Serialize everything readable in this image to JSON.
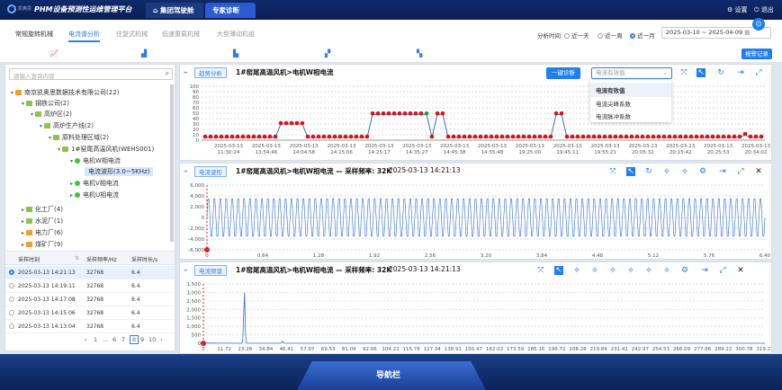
{
  "app": {
    "logo_text": "凯奥思",
    "title": "PHM设备预测性运维管理平台",
    "tabs": [
      {
        "label": "集团驾驶舱"
      },
      {
        "label": "专家诊断"
      }
    ],
    "settings": "设置",
    "logout": "退出"
  },
  "subnav": {
    "machine_tabs": [
      "常规旋转机械",
      "往复式机械",
      "低速重载机械",
      "大型薄动机组"
    ],
    "analysis_tab": "电流谱分析",
    "time_label": "分析时间:",
    "ranges": [
      "近一天",
      "近一周",
      "近一月"
    ],
    "selected_range": "近一月",
    "start_date": "2025-03-10",
    "date_sep": "~",
    "end_date": "2025-04-09",
    "record_button": "报警记录"
  },
  "search": {
    "placeholder": "请输入查询内容"
  },
  "tree": [
    {
      "label": "南京凯奥思数据技术有限公司(22)"
    },
    {
      "label": "钢铁公司(2)"
    },
    {
      "label": "高炉区(2)"
    },
    {
      "label": "高炉生产线(2)"
    },
    {
      "label": "原料处理区域(2)"
    },
    {
      "label": "1#窑尾高温风机(WEHS001)"
    },
    {
      "label": "电机W相电流"
    },
    {
      "label": "电流波形(3.0~5KHz)"
    },
    {
      "label": "电机V相电流"
    },
    {
      "label": "电机U相电流"
    },
    {
      "label": "化工厂(4)"
    },
    {
      "label": "水泥厂(1)"
    },
    {
      "label": "电力厂(6)"
    },
    {
      "label": "煤矿厂(9)"
    }
  ],
  "samples": {
    "headers": [
      "采样时刻",
      "采样频率/Hz",
      "采样时长/s"
    ],
    "rows": [
      [
        "2025-03-13 14:21:13",
        "32768",
        "6.4"
      ],
      [
        "2025-03-13 14:19:11",
        "32768",
        "6.4"
      ],
      [
        "2025-03-13 14:17:08",
        "32768",
        "6.4"
      ],
      [
        "2025-03-13 14:15:06",
        "32768",
        "6.4"
      ],
      [
        "2025-03-13 14:13:04",
        "32768",
        "6.4"
      ]
    ],
    "pagination": {
      "prev": "‹",
      "pages": [
        "1",
        "…",
        "6",
        "7",
        "8",
        "9",
        "10"
      ],
      "current": "8",
      "next": "›"
    }
  },
  "trend": {
    "tag": "趋势分析",
    "title": "1#窑尾高温风机>电机W相电流",
    "diag_button": "一键诊断",
    "select_value": "电流有效值",
    "options": [
      "电流有效值",
      "电流尖峰系数",
      "电流脉冲系数"
    ],
    "yticks": [
      "100",
      "90",
      "80",
      "70",
      "60",
      "50",
      "40",
      "30",
      "20",
      "10",
      "0"
    ],
    "xticks": [
      [
        "2025-03-13",
        "11:30:24"
      ],
      [
        "2025-03-13",
        "13:54:46"
      ],
      [
        "2025-03-13",
        "14:04:58"
      ],
      [
        "2025-03-13",
        "14:15:06"
      ],
      [
        "2025-03-13",
        "14:25:17"
      ],
      [
        "2025-03-13",
        "14:35:27"
      ],
      [
        "2025-03-13",
        "14:45:38"
      ],
      [
        "2025-03-13",
        "14:55:48"
      ],
      [
        "2025-03-13",
        "19:25:00"
      ],
      [
        "2025-03-13",
        "19:45:11"
      ],
      [
        "2025-03-13",
        "19:55:21"
      ],
      [
        "2025-03-13",
        "20:05:32"
      ],
      [
        "2025-03-13",
        "20:15:42"
      ],
      [
        "2025-03-13",
        "20:25:53"
      ],
      [
        "2025-03-13",
        "20:34:02"
      ]
    ]
  },
  "wave": {
    "tag": "电流波形",
    "title": "1#窑尾高温风机>电机W相电流 — 采样频率: 32K",
    "time": "2025-03-13 14:21:13",
    "yticks": [
      "6,000",
      "4,000",
      "2,000",
      "0",
      "-2,000",
      "-4,000",
      "-6,000"
    ],
    "xticks": [
      "0",
      "0.64",
      "1.28",
      "1.92",
      "2.56",
      "3.20",
      "3.84",
      "4.48",
      "5.12",
      "5.76",
      "6.40"
    ]
  },
  "spectrum": {
    "tag": "电流频谱",
    "title": "1#窑尾高温风机>电机W相电流 — 采样频率: 32K",
    "time": "2025-03-13 14:21:13",
    "yticks": [
      "3,500",
      "3,000",
      "2,500",
      "2,000",
      "1,500",
      "1,000",
      "500",
      "0"
    ],
    "xticks": [
      "0",
      "11.72",
      "23.28",
      "34.84",
      "46.41",
      "57.97",
      "69.53",
      "81.09",
      "92.66",
      "104.22",
      "115.78",
      "127.34",
      "138.91",
      "150.47",
      "162.03",
      "173.59",
      "185.16",
      "196.72",
      "208.28",
      "219.84",
      "231.41",
      "242.97",
      "254.53",
      "266.09",
      "277.66",
      "289.22",
      "300.78",
      "319.23"
    ]
  },
  "chart_data": [
    {
      "type": "line",
      "title": "1#窑尾高温风机>电机W相电流",
      "ylim": [
        0,
        100
      ],
      "x": [
        "11:30:24",
        "13:54:46",
        "14:04:58",
        "14:15:06",
        "14:25:17",
        "14:35:27",
        "14:45:38",
        "14:55:48",
        "19:25:00",
        "19:45:11",
        "19:55:21",
        "20:05:32",
        "20:15:42",
        "20:25:53",
        "20:34:02"
      ],
      "values": [
        5,
        5,
        5,
        5,
        5,
        5,
        5,
        5,
        5,
        5,
        5,
        5,
        5,
        5,
        30,
        30,
        30,
        30,
        30,
        5,
        5,
        5,
        5,
        5,
        5,
        5,
        5,
        5,
        5,
        5,
        5,
        48,
        48,
        48,
        48,
        48,
        48,
        48,
        48,
        48,
        48,
        48,
        5,
        48,
        48,
        5,
        5,
        5,
        5,
        5,
        5,
        5,
        5,
        5,
        5,
        5,
        5,
        5,
        5,
        5,
        5,
        5,
        5,
        5,
        5,
        48,
        48,
        5,
        5,
        5,
        5,
        5,
        5,
        5,
        5,
        5,
        5,
        5,
        5,
        5,
        5,
        5,
        5,
        5,
        5,
        5,
        5,
        5,
        5,
        5,
        5,
        5,
        5,
        5,
        5,
        5,
        5,
        5,
        5,
        5,
        10,
        5,
        5,
        5
      ]
    },
    {
      "type": "line",
      "title": "电流波形",
      "xlim": [
        0,
        6.4
      ],
      "ylim": [
        -6000,
        6000
      ],
      "amplitude": 4000
    },
    {
      "type": "line",
      "title": "电流频谱",
      "xlim": [
        0,
        319.23
      ],
      "ylim": [
        0,
        3500
      ],
      "peaks": [
        [
          23.28,
          3200
        ],
        [
          45,
          150
        ]
      ]
    }
  ],
  "footer": {
    "label": "导航栏"
  }
}
